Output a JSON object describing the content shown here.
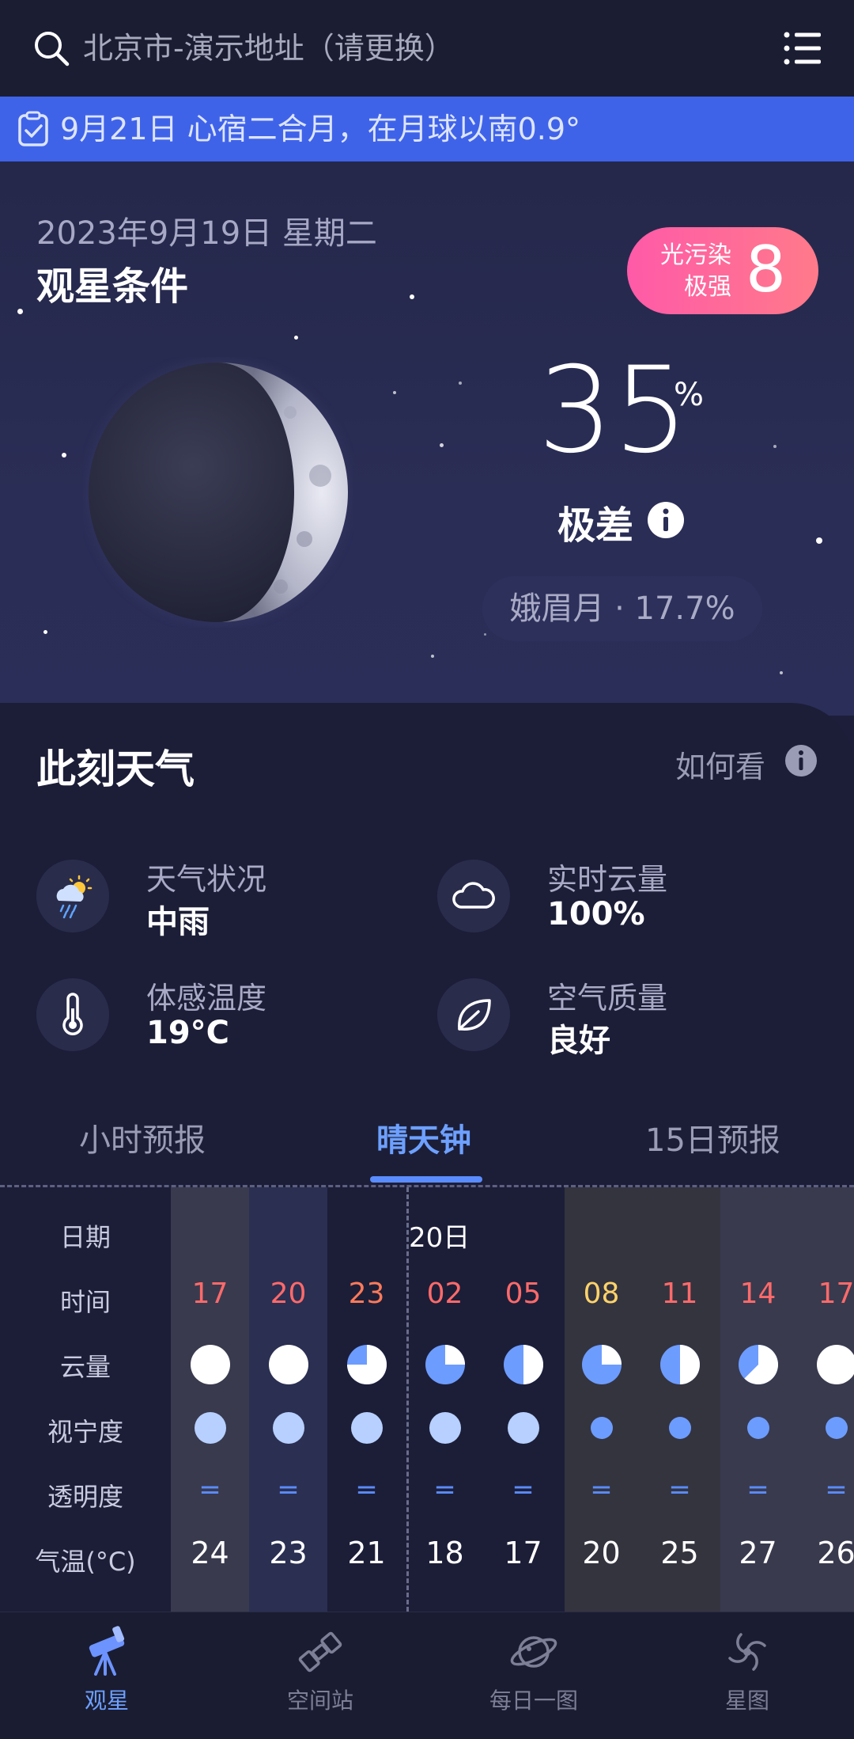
{
  "search": {
    "location": "北京市-演示地址（请更换）"
  },
  "banner": {
    "text": "9月21日 心宿二合月，在月球以南0.9°"
  },
  "sky": {
    "date": "2023年9月19日 星期二",
    "title": "观星条件",
    "light_pollution_label_1": "光污染",
    "light_pollution_label_2": "极强",
    "light_pollution_value": "8",
    "score": "35",
    "score_unit": "%",
    "quality": "极差",
    "moon_phase": "娥眉月 · 17.7%"
  },
  "weather": {
    "title": "此刻天气",
    "howto": "如何看",
    "items": [
      {
        "label": "天气状况",
        "value": "中雨",
        "icon": "rain-sun-icon"
      },
      {
        "label": "实时云量",
        "value": "100%",
        "icon": "cloud-icon"
      },
      {
        "label": "体感温度",
        "value": "19°C",
        "icon": "thermometer-icon"
      },
      {
        "label": "空气质量",
        "value": "良好",
        "icon": "leaf-icon"
      }
    ]
  },
  "tabs": [
    {
      "label": "小时预报",
      "active": false
    },
    {
      "label": "晴天钟",
      "active": true
    },
    {
      "label": "15日预报",
      "active": false
    }
  ],
  "clock": {
    "row_labels": [
      "日期",
      "时间",
      "云量",
      "视宁度",
      "透明度",
      "气温(°C)"
    ],
    "day_label": "20日",
    "times": [
      "17",
      "20",
      "23",
      "02",
      "05",
      "08",
      "11",
      "14",
      "17"
    ],
    "time_colors": [
      "#ff6a6a",
      "#ff6a6a",
      "#ff7a5a",
      "#ff6a6a",
      "#ff6a6a",
      "#ffd36a",
      "#ff6a6a",
      "#ff6a6a",
      "#ff6a6a"
    ],
    "cloud_cover": [
      1.0,
      1.0,
      0.75,
      0.25,
      0.5,
      0.25,
      0.5,
      0.625,
      1.0
    ],
    "seeing_level": [
      "large",
      "large",
      "large",
      "large",
      "large",
      "small",
      "small",
      "small",
      "small"
    ],
    "transparency": [
      "＝",
      "＝",
      "＝",
      "＝",
      "＝",
      "＝",
      "＝",
      "＝",
      "＝"
    ],
    "temps": [
      "24",
      "23",
      "21",
      "18",
      "17",
      "20",
      "25",
      "27",
      "26"
    ]
  },
  "nav": [
    {
      "label": "观星",
      "icon": "telescope-icon",
      "active": true
    },
    {
      "label": "空间站",
      "icon": "space-station-icon",
      "active": false
    },
    {
      "label": "每日一图",
      "icon": "planet-icon",
      "active": false
    },
    {
      "label": "星图",
      "icon": "galaxy-icon",
      "active": false
    }
  ],
  "colors": {
    "accent": "#5b8cff",
    "banner": "#3f63e8",
    "badge": "#ff5aa8"
  }
}
